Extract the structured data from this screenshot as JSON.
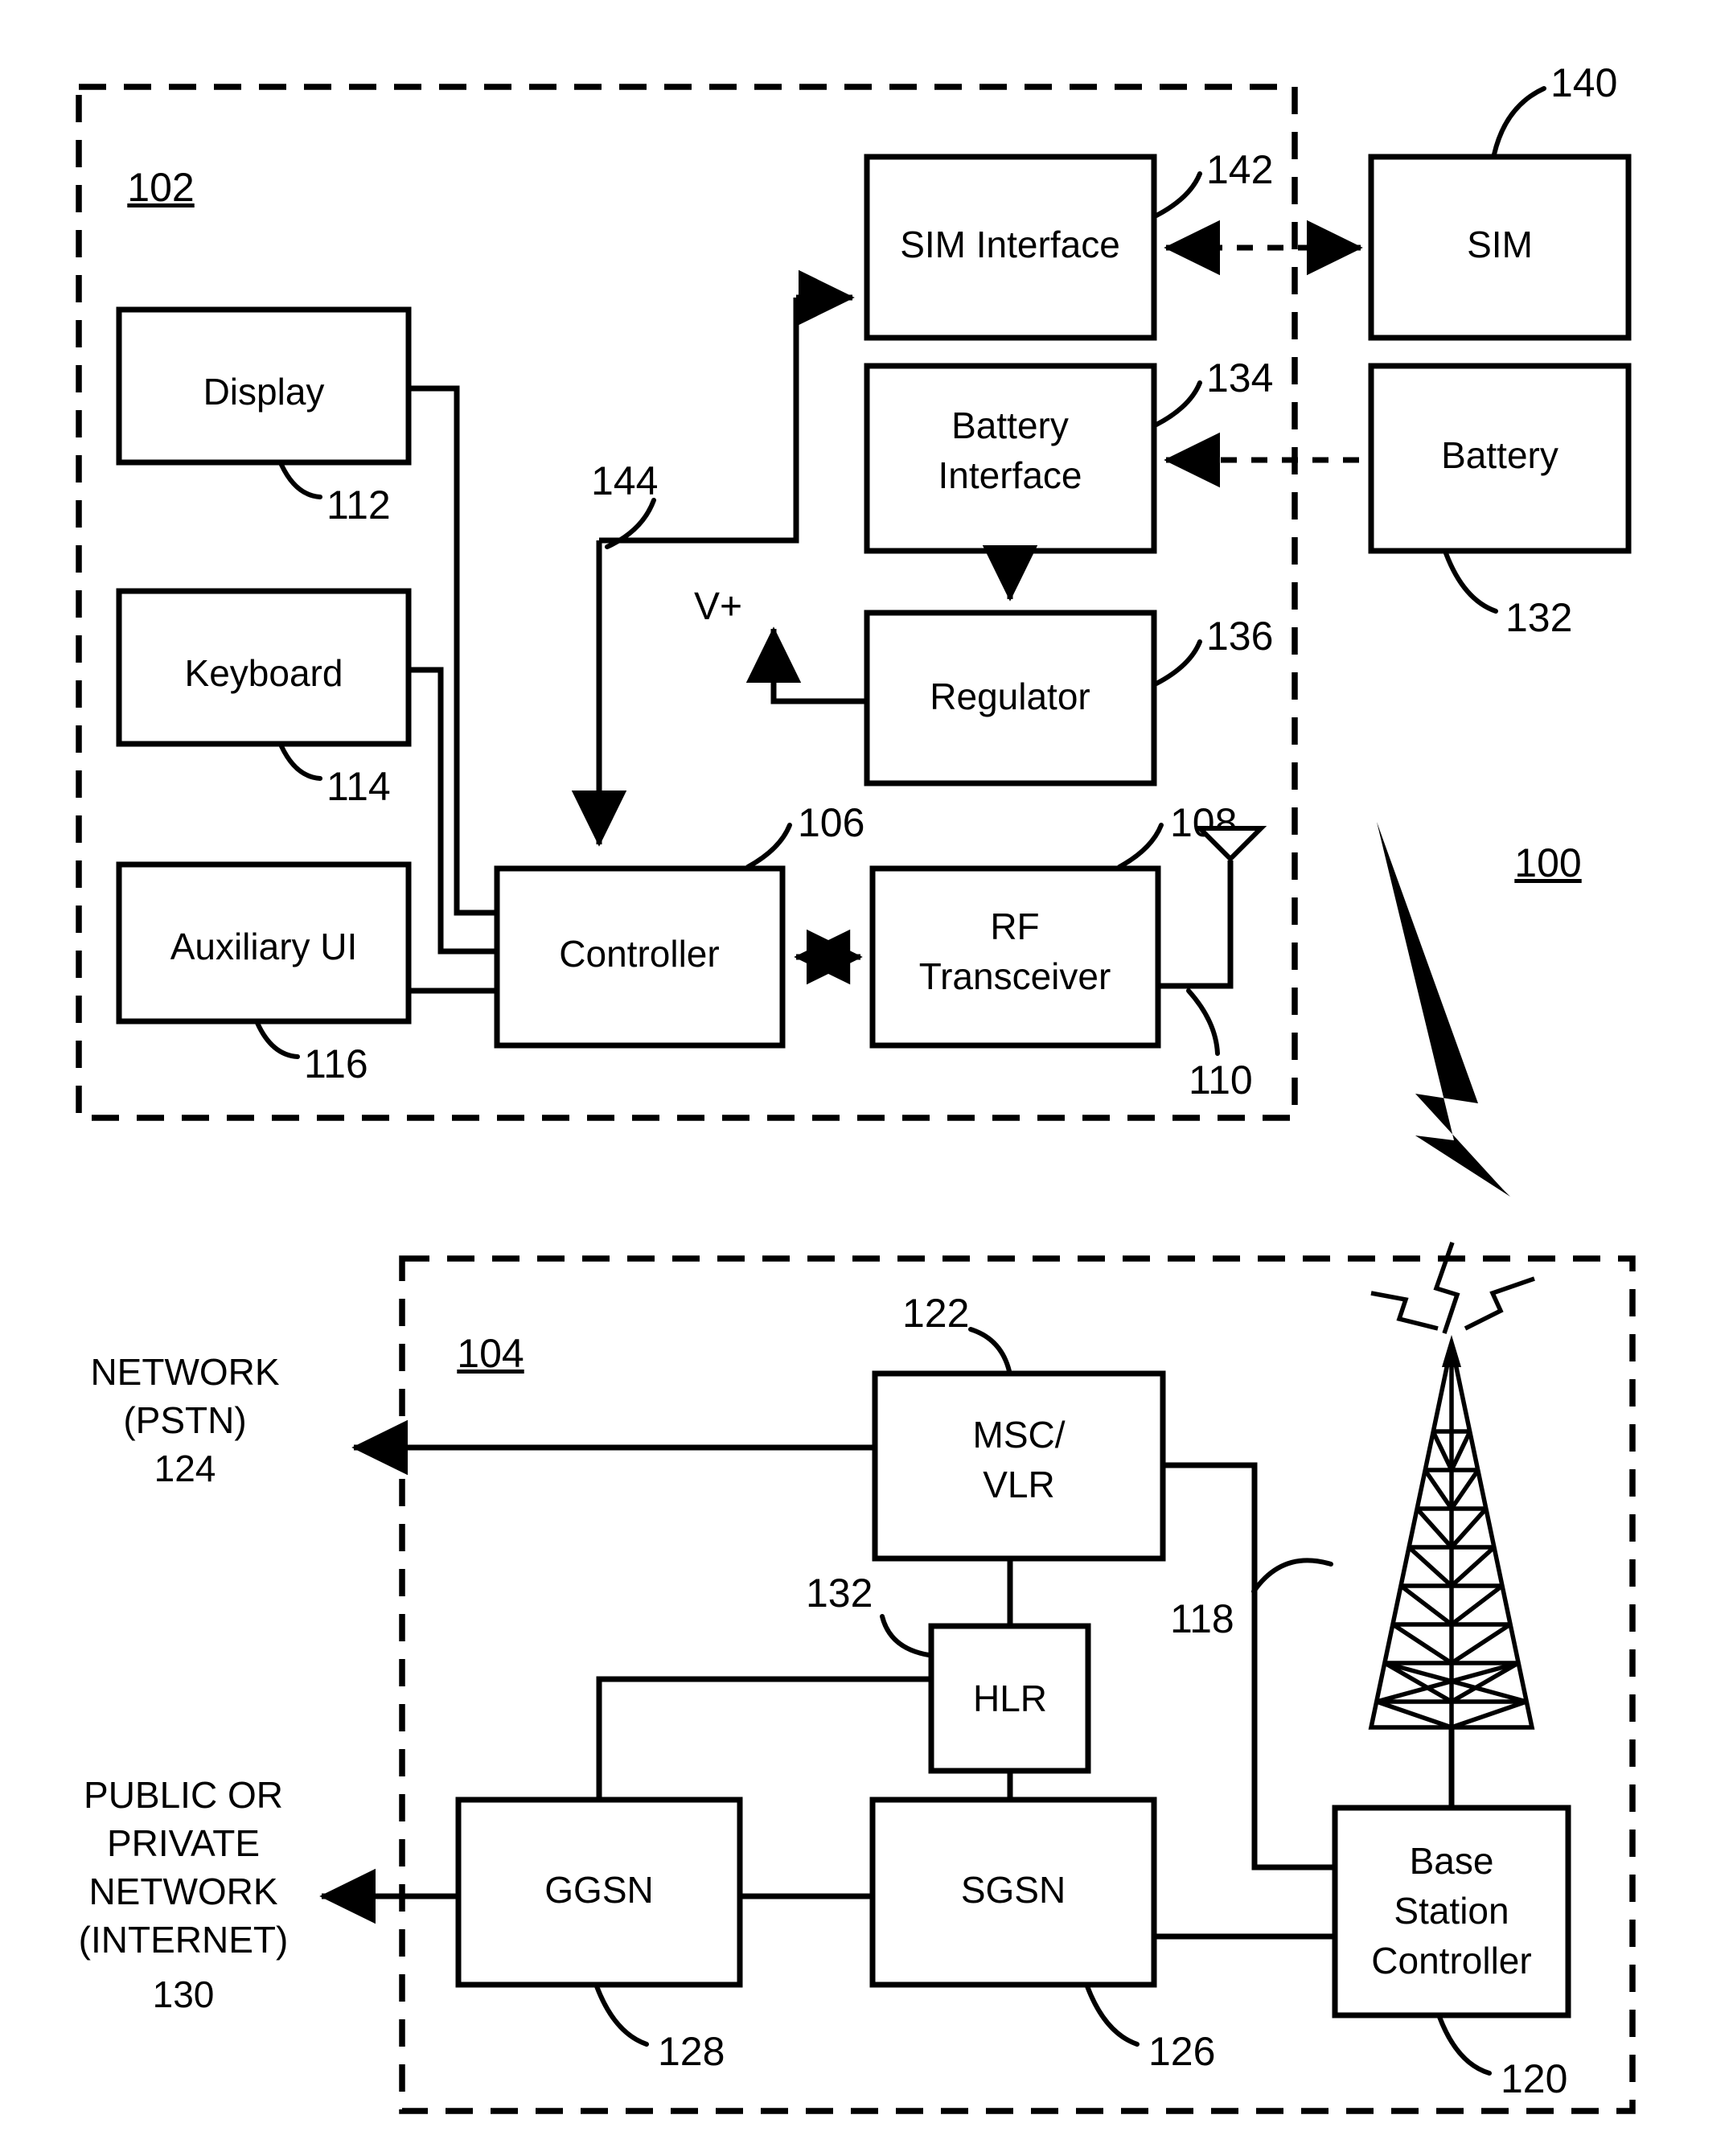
{
  "figure": {
    "system_ref": "100",
    "mobile_device_ref": "102",
    "network_ref": "104"
  },
  "mobile": {
    "boxes": {
      "display": "Display",
      "keyboard": "Keyboard",
      "auxiliary_ui": "Auxiliary UI",
      "controller": "Controller",
      "rf_transceiver_line1": "RF",
      "rf_transceiver_line2": "Transceiver",
      "sim_interface": "SIM Interface",
      "battery_interface_line1": "Battery",
      "battery_interface_line2": "Interface",
      "regulator": "Regulator",
      "sim": "SIM",
      "battery": "Battery"
    },
    "refs": {
      "display": "112",
      "keyboard": "114",
      "auxiliary_ui": "116",
      "controller": "106",
      "rf_transceiver": "108",
      "antenna": "110",
      "sim_interface": "142",
      "battery_interface": "134",
      "regulator": "136",
      "sim": "140",
      "battery": "132",
      "bus": "144"
    },
    "voltage_label": "V+"
  },
  "network": {
    "boxes": {
      "msc_vlr_line1": "MSC/",
      "msc_vlr_line2": "VLR",
      "hlr": "HLR",
      "ggsn": "GGSN",
      "sgsn": "SGSN",
      "bsc_line1": "Base",
      "bsc_line2": "Station",
      "bsc_line3": "Controller"
    },
    "refs": {
      "msc_vlr": "122",
      "hlr": "132",
      "ggsn": "128",
      "sgsn": "126",
      "bsc": "120",
      "tower": "118"
    },
    "external": {
      "pstn_line1": "NETWORK",
      "pstn_line2": "(PSTN)",
      "pstn_ref": "124",
      "internet_line1": "PUBLIC OR",
      "internet_line2": "PRIVATE",
      "internet_line3": "NETWORK",
      "internet_line4": "(INTERNET)",
      "internet_ref": "130"
    }
  }
}
